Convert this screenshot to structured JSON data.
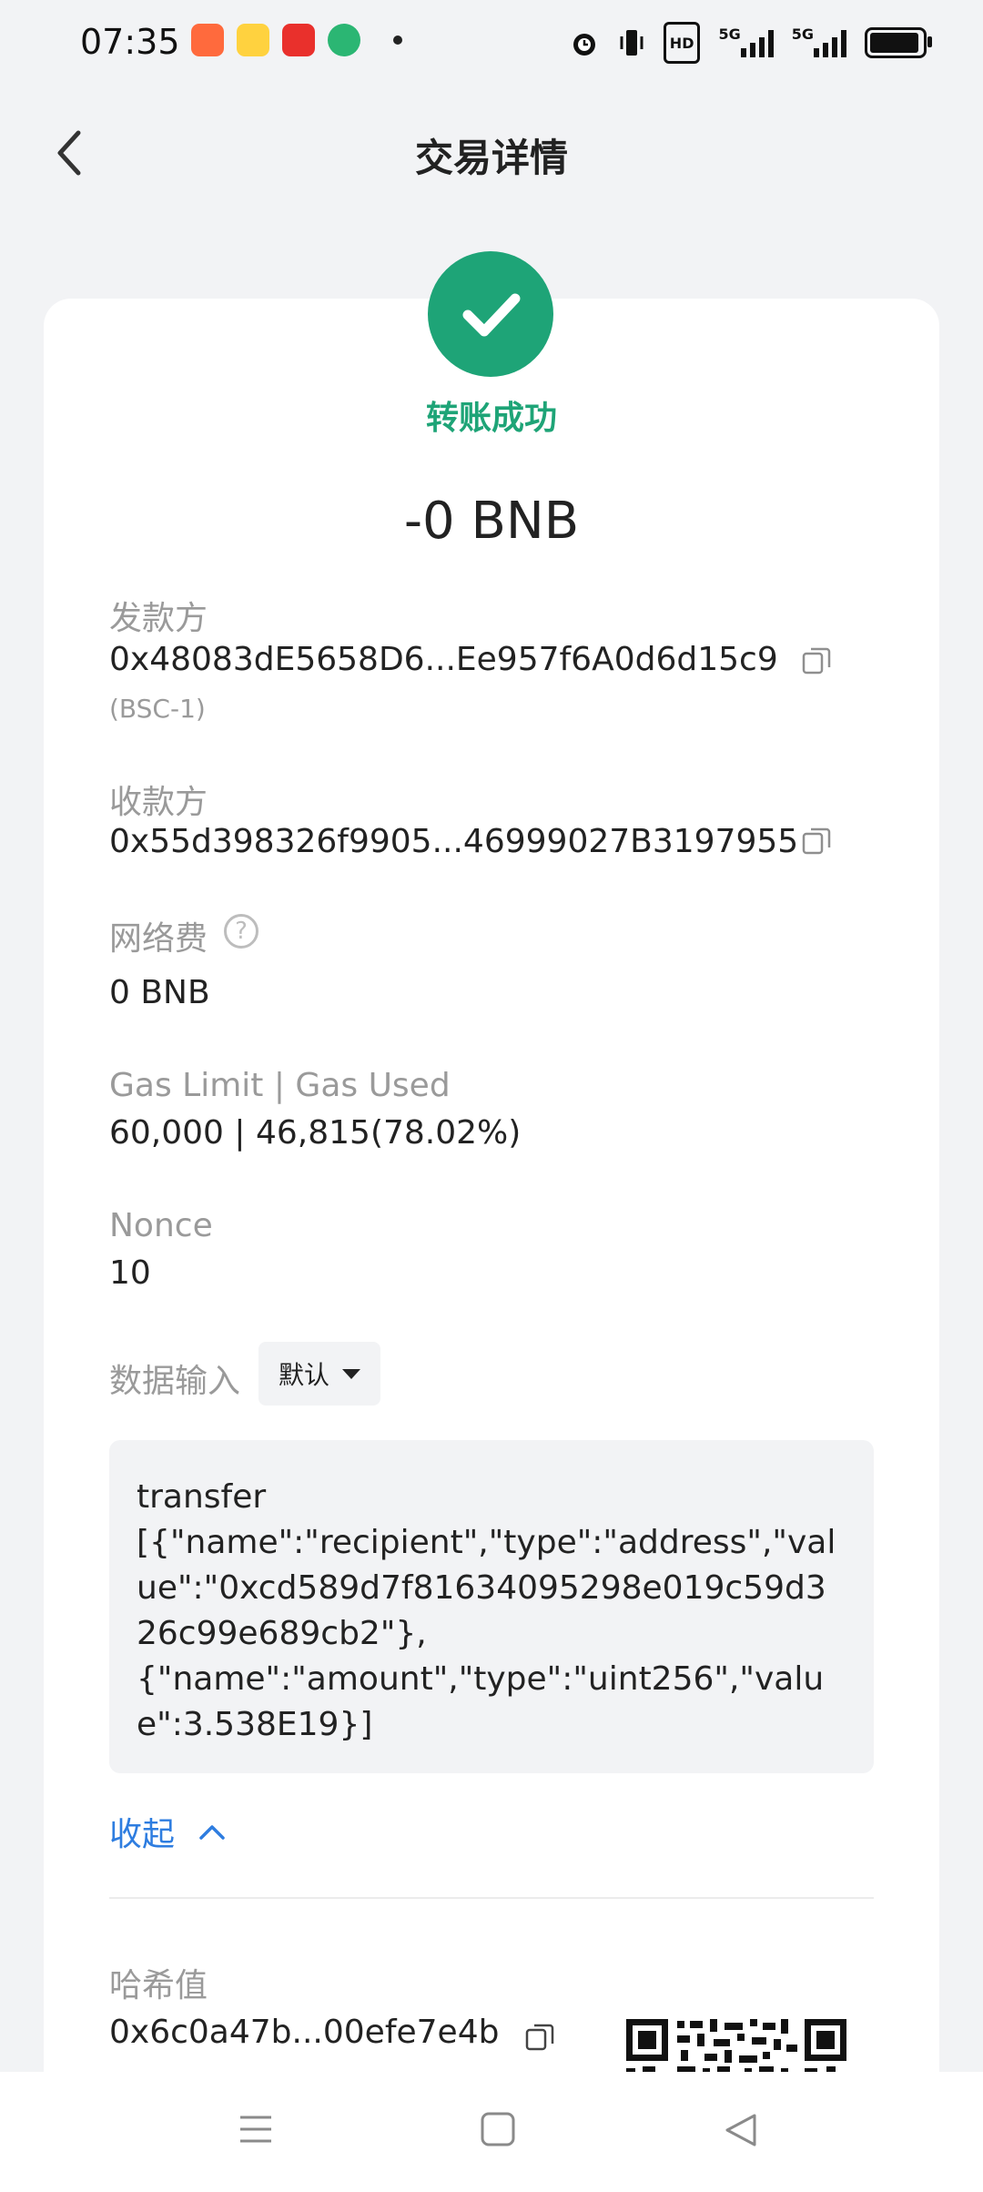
{
  "status_bar": {
    "time": "07:35",
    "app_icons": [
      {
        "name": "app-icon-1",
        "color": "#ff6a3d"
      },
      {
        "name": "app-icon-2",
        "color": "#ffd23f"
      },
      {
        "name": "app-icon-3",
        "color": "#e9302c"
      },
      {
        "name": "app-icon-4",
        "color": "#2bb673"
      }
    ],
    "hd_label": "HD",
    "net1_label": "5G",
    "net2_label": "5G"
  },
  "header": {
    "title": "交易详情"
  },
  "status": {
    "text": "转账成功",
    "color": "#1ea477"
  },
  "amount": "-0 BNB",
  "sender": {
    "label": "发款方",
    "address": "0x48083dE5658D6...Ee957f6A0d6d15c9",
    "network": "(BSC-1)"
  },
  "receiver": {
    "label": "收款方",
    "address": "0x55d398326f9905...46999027B3197955"
  },
  "fee": {
    "label": "网络费",
    "value": "0 BNB",
    "help": "?"
  },
  "gas": {
    "label": "Gas Limit | Gas Used",
    "value": "60,000 | 46,815(78.02%)"
  },
  "nonce": {
    "label": "Nonce",
    "value": "10"
  },
  "data_input": {
    "label": "数据输入",
    "mode": "默认",
    "content": "transfer\n[{\"name\":\"recipient\",\"type\":\"address\",\"value\":\"0xcd589d7f81634095298e019c59d326c99e689cb2\"},\n{\"name\":\"amount\",\"type\":\"uint256\",\"value\":3.538E19}]"
  },
  "collapse_label": "收起",
  "hash": {
    "label": "哈希值",
    "value": "0x6c0a47b...00efe7e4b"
  },
  "colors": {
    "accent_blue": "#2e7de0",
    "success_green": "#1ea477"
  }
}
